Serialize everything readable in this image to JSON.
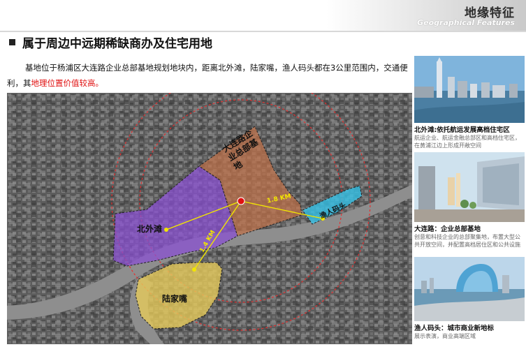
{
  "header": {
    "title": "地缘特征",
    "subtitle": "Geographical Features"
  },
  "section": {
    "title": "属于周边中远期稀缺商办及住宅用地"
  },
  "intro": {
    "text": "基地位于杨浦区大连路企业总部基地规划地块内，距离北外滩，陆家嘴，渔人码头都在3公里范围内，交通便利，其",
    "highlight": "地理位置价值较高。"
  },
  "map": {
    "areas": [
      {
        "label": "北外滩",
        "color": "#8a4fd6"
      },
      {
        "label": "大连路企业总部基地",
        "color": "#c0714a"
      },
      {
        "label": "渔人码头",
        "color": "#35c4ea"
      },
      {
        "label": "陆家嘴",
        "color": "#e8cc5a"
      }
    ],
    "distances": [
      "1.8 KM",
      "1.4 KM"
    ]
  },
  "side_cards": [
    {
      "caption": "北外滩:依托航运发展高档住宅区",
      "desc": "航运企业、航运金融总部区和高档住宅区，在黄浦江边上形成开敞空间"
    },
    {
      "caption": "大连路：企业总部基地",
      "desc": "创意和科技企业的总部聚集地，布置大型公共开放空间，并配置高档居住区和公共设施"
    },
    {
      "caption": "渔人码头：城市商业新地标",
      "desc": "展示表演，商业高端区域"
    }
  ]
}
